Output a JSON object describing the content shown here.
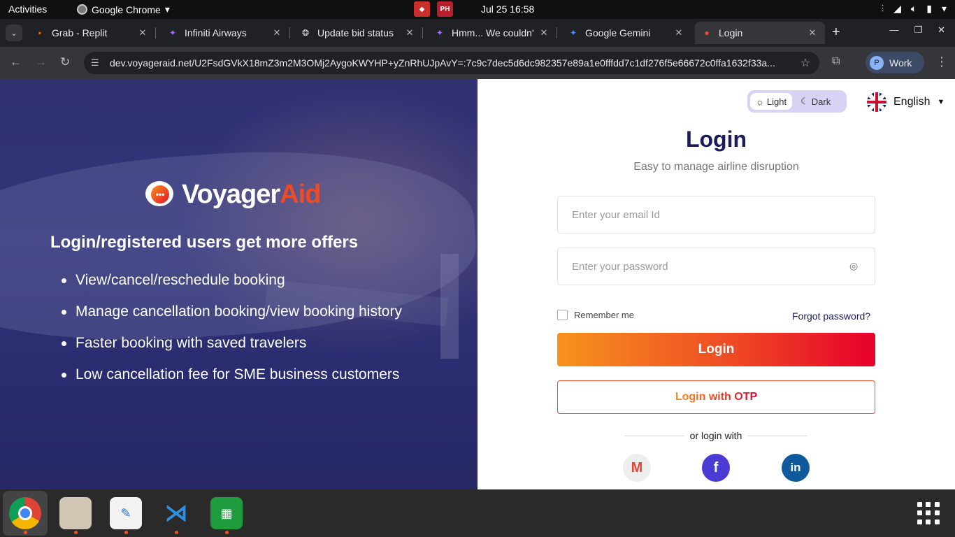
{
  "system": {
    "activities": "Activities",
    "app_name": "Google Chrome",
    "clock": "Jul 25  16:58"
  },
  "browser": {
    "tabs": [
      {
        "title": "Grab - Replit",
        "icon": "replit-icon"
      },
      {
        "title": "Infiniti Airways",
        "icon": "gemini-sparkle-icon"
      },
      {
        "title": "Update bid status",
        "icon": "openai-icon"
      },
      {
        "title": "Hmm... We couldn't",
        "icon": "gemini-sparkle-icon"
      },
      {
        "title": "Google Gemini",
        "icon": "gemini-icon"
      },
      {
        "title": "Login",
        "icon": "voyageraid-icon",
        "active": true
      }
    ],
    "url_host": "dev.voyageraid.net",
    "url_path": "/U2FsdGVkX18mZ3m2M3OMj2AygoKWYHP+yZnRhUJpAvY=:7c9c7dec5d6dc982357e89a1e0fffdd7c1df276f5e66672c0ffa1632f33a...",
    "profile_label": "Work",
    "profile_initial": "P"
  },
  "hero": {
    "brand_part1": "Voyager",
    "brand_part2": "Aid",
    "heading": "Login/registered users get more offers",
    "benefits": [
      "View/cancel/reschedule booking",
      "Manage cancellation booking/view booking history",
      "Faster booking with saved travelers",
      "Low cancellation fee for SME business customers"
    ]
  },
  "login": {
    "theme_light": "Light",
    "theme_dark": "Dark",
    "language": "English",
    "title": "Login",
    "subtitle": "Easy to manage airline disruption",
    "email_placeholder": "Enter your email Id",
    "password_placeholder": "Enter your password",
    "remember_label": "Remember me",
    "forgot_label": "Forgot password?",
    "login_button": "Login",
    "otp_button": "Login with OTP",
    "or_text": "or login with"
  },
  "colors": {
    "brand_orange": "#f7931e",
    "brand_red": "#e6002a",
    "title_navy": "#1b1b5e",
    "theme_toggle_bg": "#d9d2f5"
  },
  "dock": [
    "chrome-icon",
    "files-icon",
    "text-editor-icon",
    "vscode-icon",
    "libreoffice-calc-icon"
  ]
}
